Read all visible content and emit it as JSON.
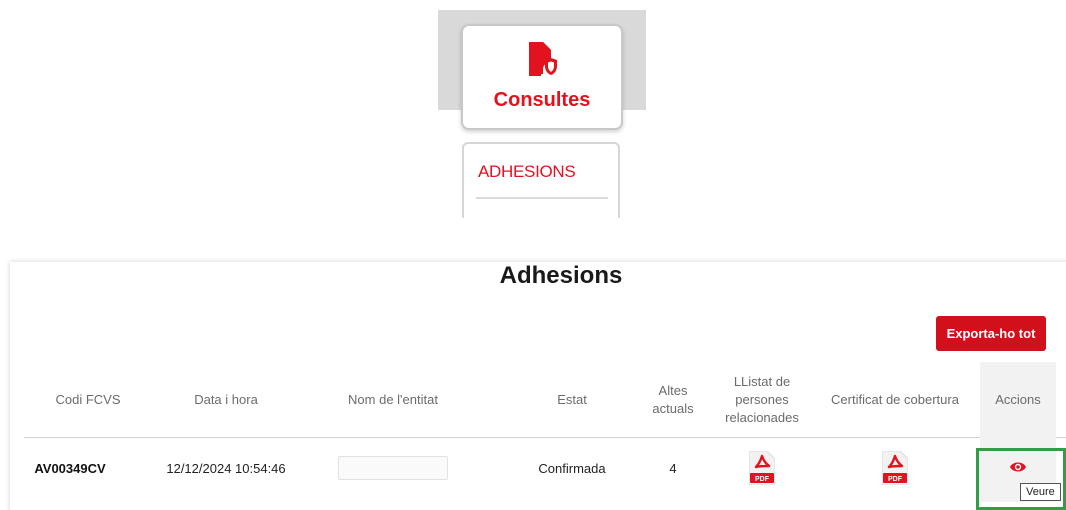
{
  "menu": {
    "consultes_label": "Consultes",
    "consultes_icon": "document-shield-icon",
    "submenu_item": "ADHESIONS"
  },
  "panel": {
    "title": "Adhesions",
    "export_label": "Exporta-ho tot"
  },
  "table": {
    "headers": {
      "codi": "Codi FCVS",
      "data": "Data i hora",
      "nom": "Nom de l'entitat",
      "estat": "Estat",
      "altes_1": "Altes",
      "altes_2": "actuals",
      "llistat_1": "LListat de",
      "llistat_2": "persones",
      "llistat_3": "relacionades",
      "certificat": "Certificat de cobertura",
      "accions": "Accions"
    },
    "rows": [
      {
        "codi": "AV00349CV",
        "data": "12/12/2024 10:54:46",
        "nom": "",
        "estat": "Confirmada",
        "altes": "4",
        "pdf_label": "PDF"
      }
    ]
  },
  "tooltip": "Veure",
  "colors": {
    "accent": "#d2101c",
    "highlight": "#2ea043"
  }
}
